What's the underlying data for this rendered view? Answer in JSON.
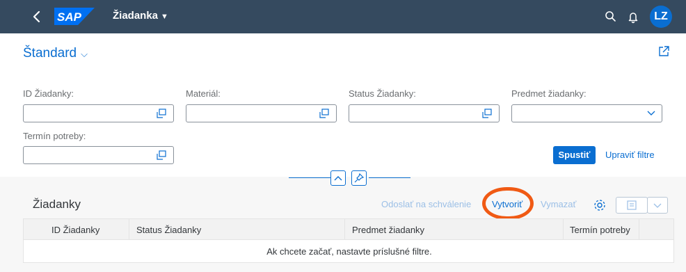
{
  "shell": {
    "logo_text": "SAP",
    "app_title": "Žiadanka",
    "avatar_initials": "LZ",
    "colors": {
      "bar": "#354a5f",
      "accent": "#0a6ed1",
      "logo": "#0070f2"
    },
    "icons": [
      "back-icon",
      "search-icon",
      "bell-icon"
    ]
  },
  "filterbar": {
    "variant": "Štandard",
    "fields": [
      {
        "label": "ID Žiadanky:",
        "value": "",
        "icon": "value-help-icon"
      },
      {
        "label": "Materiál:",
        "value": "",
        "icon": "value-help-icon"
      },
      {
        "label": "Status Žiadanky:",
        "value": "",
        "icon": "value-help-icon"
      },
      {
        "label": "Predmet žiadanky:",
        "value": "",
        "icon": "chevron-down-icon"
      },
      {
        "label": "Termín potreby:",
        "value": "",
        "icon": "value-help-icon"
      }
    ],
    "go_label": "Spustiť",
    "adapt_label": "Upraviť filtre"
  },
  "table": {
    "title": "Žiadanky",
    "toolbar": {
      "send_label": "Odoslať na schválenie",
      "create_label": "Vytvoriť",
      "delete_label": "Vymazať"
    },
    "columns": [
      "ID Žiadanky",
      "Status Žiadanky",
      "Predmet žiadanky",
      "Termín potreby"
    ],
    "rows": [],
    "empty_text": "Ak chcete začať, nastavte príslušné filtre."
  },
  "annotation": {
    "color": "#f05a14",
    "target": "create-button"
  }
}
